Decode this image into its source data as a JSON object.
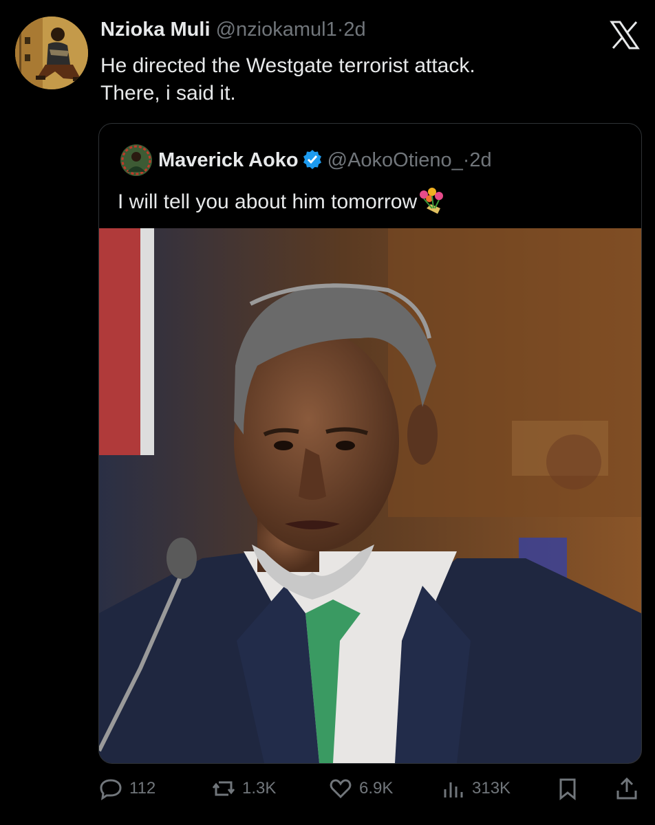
{
  "tweet": {
    "author_name": "Nzioka Muli",
    "author_handle": "@nziokamul1",
    "separator": "·",
    "time": "2d",
    "text_line1": "He directed the Westgate terrorist attack.",
    "text_line2": "There, i said it."
  },
  "quote": {
    "author_name": "Maverick Aoko",
    "author_handle": "@AokoOtieno_",
    "separator": "·",
    "time": "2d",
    "text": "I will tell you about him tomorrow",
    "verified": true,
    "emoji": "bouquet-emoji"
  },
  "actions": {
    "replies": "112",
    "reposts": "1.3K",
    "likes": "6.9K",
    "views": "313K"
  },
  "icons": [
    "x-logo-icon",
    "verified-badge-icon",
    "reply-icon",
    "repost-icon",
    "like-icon",
    "views-icon",
    "bookmark-icon",
    "share-icon"
  ],
  "colors": {
    "background": "#000000",
    "text": "#e7e9ea",
    "secondary": "#71767b",
    "verified": "#1d9bf0",
    "border": "#2f3336"
  }
}
